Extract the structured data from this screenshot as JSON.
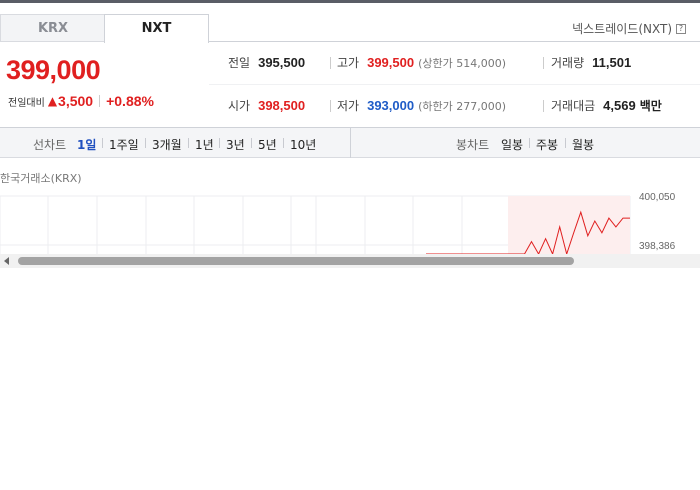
{
  "market_tabs": [
    {
      "label": "KRX",
      "active": false
    },
    {
      "label": "NXT",
      "active": true
    }
  ],
  "venue_label": "넥스트레이드(NXT)",
  "help_icon": "?",
  "price": "399,000",
  "change": {
    "label": "전일대비",
    "arrow": "▲",
    "amount": "3,500",
    "percent": "+0.88%"
  },
  "stats": {
    "prev_close": {
      "label": "전일",
      "value": "395,500"
    },
    "high": {
      "label": "고가",
      "value": "399,500",
      "limit_label": "(상한가 514,000)"
    },
    "volume": {
      "label": "거래량",
      "value": "11,501"
    },
    "open": {
      "label": "시가",
      "value": "398,500"
    },
    "low": {
      "label": "저가",
      "value": "393,000",
      "limit_label": "(하한가 277,000)"
    },
    "trade_value": {
      "label": "거래대금",
      "value": "4,569",
      "unit": "백만"
    }
  },
  "line_chart_bar": {
    "heading": "선차트",
    "periods": [
      "1일",
      "1주일",
      "3개월",
      "1년",
      "3년",
      "5년",
      "10년"
    ],
    "active": "1일"
  },
  "candle_chart_bar": {
    "heading": "봉차트",
    "periods": [
      "일봉",
      "주봉",
      "월봉"
    ]
  },
  "chart_caption": "한국거래소(KRX)",
  "colors": {
    "up": "#e02020",
    "down": "#1f5cc7",
    "active_period": "#1f4fbf"
  },
  "chart_data": {
    "type": "line",
    "title": "",
    "y_tick_labels": [
      "400,050",
      "398,386"
    ],
    "series": [
      {
        "values": [
          393800,
          394200,
          393800,
          394200,
          393800,
          394000,
          393800,
          393800,
          394500,
          395600,
          396000,
          394800,
          395200,
          394800,
          397000,
          398500,
          397200,
          398600,
          397600,
          399000,
          397800,
          398800,
          399500,
          398700,
          399200,
          398800,
          399300,
          399000,
          399300,
          399300
        ]
      }
    ]
  }
}
